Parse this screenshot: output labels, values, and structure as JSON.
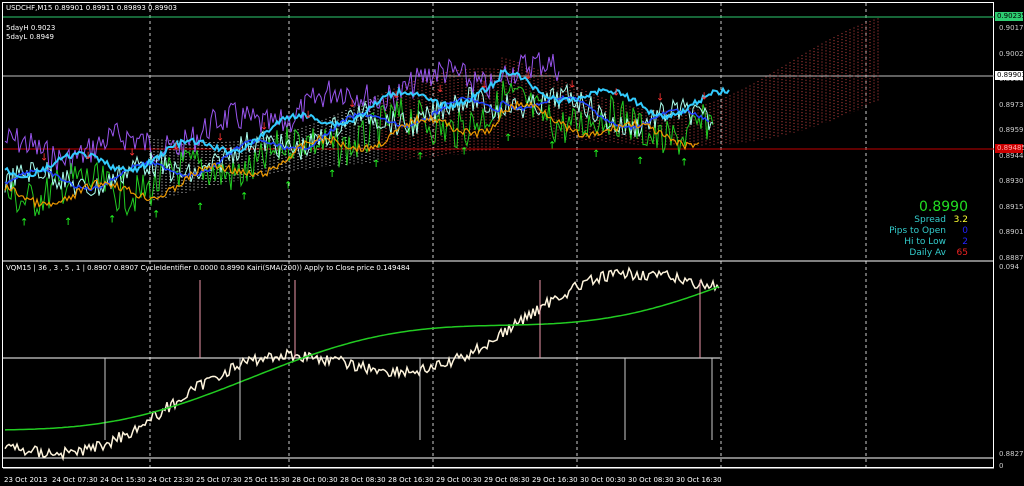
{
  "chart": {
    "symbol_header": "USDCHF,M15  0.89901 0.89911 0.89893 0.89903",
    "day_high": "5dayH 0.9023",
    "day_low": "5dayL 0.8949"
  },
  "indicator": {
    "header": "VQM15 | 36 , 3 , 5 , 1  | 0.8907 0.8907  CycleIdentifier 0.0000 0.8990  Kairi(SMA(200)) Apply to Close price 0.149484",
    "axis_top": "0.094",
    "axis_bottom": "0.8827"
  },
  "sub_panel": {
    "axis_label": "0"
  },
  "price_axis": [
    "0.90170",
    "0.90025",
    "0.89880",
    "0.89735",
    "0.89590",
    "0.89445",
    "0.89300",
    "0.89155",
    "0.89010",
    "0.88870"
  ],
  "price_tags": {
    "high": "0.90235",
    "current": "0.89903",
    "low": "0.89485"
  },
  "info_panel": {
    "price": "0.8990",
    "spread_label": "Spread",
    "spread": "3.2",
    "pips_label": "Pips to Open",
    "pips": "0",
    "hilo_label": "Hi to Low",
    "hilo": "2",
    "daily_label": "Daily Av",
    "daily": "65"
  },
  "time_axis": [
    "23 Oct 2013",
    "24 Oct 07:30",
    "24 Oct 15:30",
    "24 Oct 23:30",
    "25 Oct 07:30",
    "25 Oct 15:30",
    "28 Oct 00:30",
    "28 Oct 08:30",
    "28 Oct 16:30",
    "29 Oct 00:30",
    "29 Oct 08:30",
    "29 Oct 16:30",
    "30 Oct 00:30",
    "30 Oct 08:30",
    "30 Oct 16:30"
  ],
  "colors": {
    "high_line": "#2ecc71",
    "current_line": "#c0c0c0",
    "low_line": "#c00000",
    "info_price": "#22dd22",
    "info_label": "#33cccc",
    "spread": "#ffff33",
    "pips": "#2222ff",
    "daily": "#ee2222"
  }
}
